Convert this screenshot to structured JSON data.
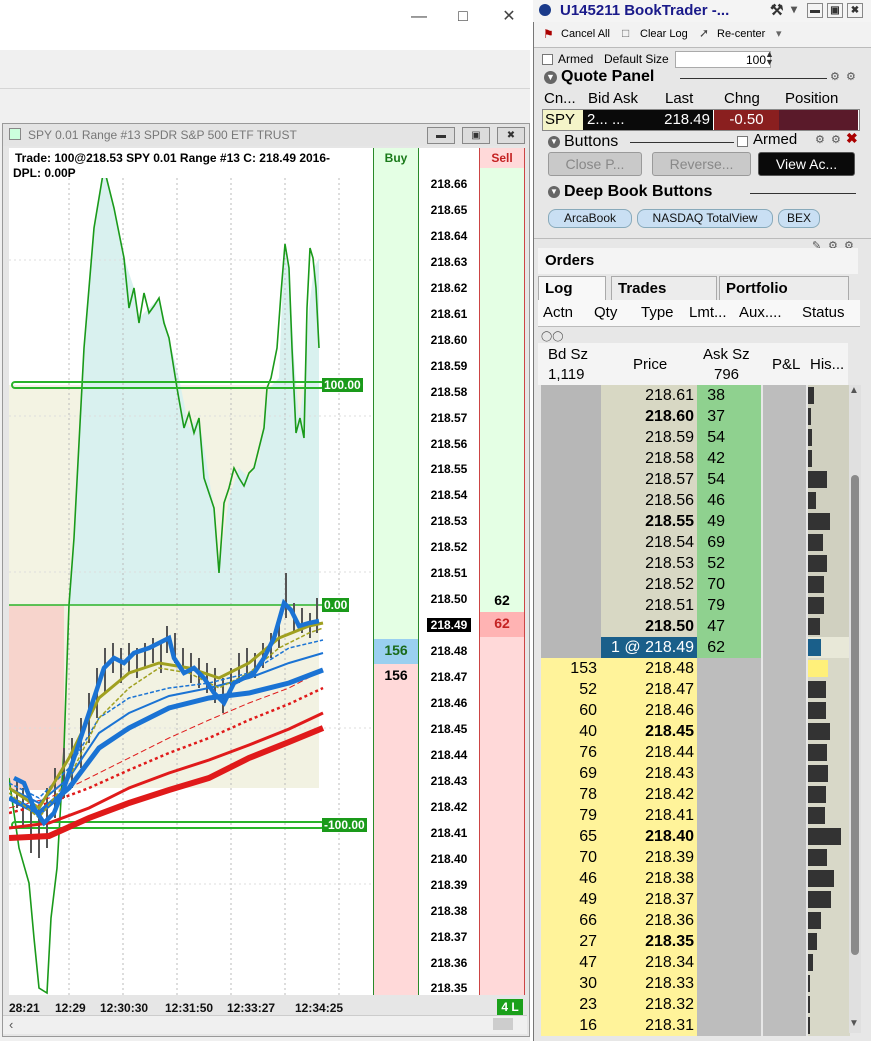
{
  "chart": {
    "title": "SPY  0.01 Range  #13  SPDR S&P 500 ETF TRUST",
    "info_line1": "Trade: 100@218.53  SPY  0.01 Range  #13 C: 218.49 2016-",
    "info_line2": "DPL: 0.00P",
    "buy_header": "Buy",
    "sell_header": "Sell",
    "prices": [
      "218.66",
      "218.65",
      "218.64",
      "218.63",
      "218.62",
      "218.61",
      "218.60",
      "218.59",
      "218.58",
      "218.57",
      "218.56",
      "218.55",
      "218.54",
      "218.53",
      "218.52",
      "218.51",
      "218.50",
      "218.49",
      "218.48",
      "218.47",
      "218.46",
      "218.45",
      "218.44",
      "218.43",
      "218.42",
      "218.41",
      "218.40",
      "218.39",
      "218.38",
      "218.37",
      "218.36",
      "218.35"
    ],
    "current_price": "218.49",
    "buy_size_hl": "156",
    "buy_size": "156",
    "sell_size": "62",
    "sell_size_hl": "62",
    "level_upper": "100.00",
    "level_zero": "0.00",
    "level_lower": "-100.00",
    "time_ticks": [
      "28:21",
      "12:29",
      "12:30:30",
      "12:31:50",
      "12:33:27",
      "12:34:25"
    ],
    "badge": "4 L"
  },
  "booktrader": {
    "title": "U145211 BookTrader -...",
    "toolbar": {
      "cancel_all": "Cancel All",
      "clear_log": "Clear Log",
      "recenter": "Re-center"
    },
    "armed_label": "Armed",
    "default_size_label": "Default Size",
    "default_size_value": "100",
    "quote_panel": {
      "title": "Quote Panel",
      "headers": [
        "Cn...",
        "Bid Ask",
        "Last",
        "Chng",
        "Position"
      ],
      "symbol": "SPY",
      "bidask": "2... ...",
      "last": "218.49",
      "change": "-0.50"
    },
    "buttons_panel": {
      "title": "Buttons",
      "armed": "Armed",
      "close": "Close P...",
      "reverse": "Reverse...",
      "view": "View Ac..."
    },
    "deep_book": {
      "title": "Deep Book Buttons",
      "arca": "ArcaBook",
      "nasdaq": "NASDAQ TotalView",
      "bex": "BEX"
    },
    "orders": {
      "title": "Orders",
      "tabs": [
        "Log",
        "Trades",
        "Portfolio"
      ],
      "columns": [
        "Actn",
        "Qty",
        "Type",
        "Lmt...",
        "Aux....",
        "Status"
      ]
    },
    "ladder": {
      "headers": {
        "bid": "Bd Sz",
        "price": "Price",
        "ask": "Ask Sz",
        "pl": "P&L",
        "hist": "His..."
      },
      "bid_total": "1,119",
      "ask_total": "796",
      "rows": [
        {
          "price": "218.61",
          "ask": "38",
          "hist": 0.15,
          "bold": false
        },
        {
          "price": "218.60",
          "ask": "37",
          "hist": 0.08,
          "bold": true
        },
        {
          "price": "218.59",
          "ask": "54",
          "hist": 0.1,
          "bold": false
        },
        {
          "price": "218.58",
          "ask": "42",
          "hist": 0.1,
          "bold": false
        },
        {
          "price": "218.57",
          "ask": "54",
          "hist": 0.45,
          "bold": false
        },
        {
          "price": "218.56",
          "ask": "46",
          "hist": 0.18,
          "bold": false
        },
        {
          "price": "218.55",
          "ask": "49",
          "hist": 0.52,
          "bold": true
        },
        {
          "price": "218.54",
          "ask": "69",
          "hist": 0.35,
          "bold": false
        },
        {
          "price": "218.53",
          "ask": "52",
          "hist": 0.45,
          "bold": false
        },
        {
          "price": "218.52",
          "ask": "70",
          "hist": 0.38,
          "bold": false
        },
        {
          "price": "218.51",
          "ask": "79",
          "hist": 0.38,
          "bold": false
        },
        {
          "price": "218.50",
          "ask": "47",
          "hist": 0.28,
          "bold": true
        },
        {
          "price": "1 @ 218.49",
          "ask": "62",
          "hist": 0.3,
          "bold": false,
          "current": true
        },
        {
          "price": "218.48",
          "bid": "153",
          "hist": 0.48,
          "bold": false
        },
        {
          "price": "218.47",
          "bid": "52",
          "hist": 0.42,
          "bold": false
        },
        {
          "price": "218.46",
          "bid": "60",
          "hist": 0.42,
          "bold": false
        },
        {
          "price": "218.45",
          "bid": "40",
          "hist": 0.52,
          "bold": true
        },
        {
          "price": "218.44",
          "bid": "76",
          "hist": 0.45,
          "bold": false
        },
        {
          "price": "218.43",
          "bid": "69",
          "hist": 0.48,
          "bold": false
        },
        {
          "price": "218.42",
          "bid": "78",
          "hist": 0.42,
          "bold": false
        },
        {
          "price": "218.41",
          "bid": "79",
          "hist": 0.4,
          "bold": false
        },
        {
          "price": "218.40",
          "bid": "65",
          "hist": 0.78,
          "bold": true
        },
        {
          "price": "218.39",
          "bid": "70",
          "hist": 0.45,
          "bold": false
        },
        {
          "price": "218.38",
          "bid": "46",
          "hist": 0.62,
          "bold": false
        },
        {
          "price": "218.37",
          "bid": "49",
          "hist": 0.55,
          "bold": false
        },
        {
          "price": "218.36",
          "bid": "66",
          "hist": 0.3,
          "bold": false
        },
        {
          "price": "218.35",
          "bid": "27",
          "hist": 0.22,
          "bold": true
        },
        {
          "price": "218.34",
          "bid": "47",
          "hist": 0.12,
          "bold": false
        },
        {
          "price": "218.33",
          "bid": "30",
          "hist": 0.05,
          "bold": false
        },
        {
          "price": "218.32",
          "bid": "23",
          "hist": 0.04,
          "bold": false
        },
        {
          "price": "218.31",
          "bid": "16",
          "hist": 0.03,
          "bold": false
        }
      ]
    }
  },
  "colors": {
    "bid_yellow": "#fff39a",
    "ask_green": "#8fd18f",
    "current_blue": "#1a5f8a",
    "change_red": "#8a1f1f"
  }
}
